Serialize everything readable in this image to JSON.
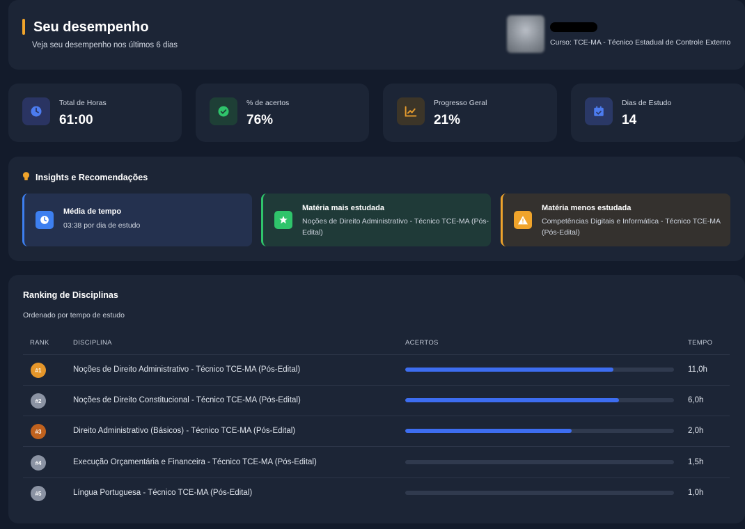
{
  "header": {
    "title": "Seu desempenho",
    "subtitle": "Veja seu desempenho nos últimos 6 dias",
    "course": "Curso: TCE-MA - Técnico Estadual de Controle Externo"
  },
  "stats": [
    {
      "label": "Total de Horas",
      "value": "61:00",
      "icon": "clock-icon",
      "color": "#4c7cf0",
      "bg": "#2a3462"
    },
    {
      "label": "% de acertos",
      "value": "76%",
      "icon": "check-circle-icon",
      "color": "#2fc46b",
      "bg": "#1e3f36"
    },
    {
      "label": "Progresso Geral",
      "value": "21%",
      "icon": "trend-chart-icon",
      "color": "#e59b2e",
      "bg": "#3c3528"
    },
    {
      "label": "Dias de Estudo",
      "value": "14",
      "icon": "calendar-check-icon",
      "color": "#4c7cf0",
      "bg": "#2a3866"
    }
  ],
  "insights": {
    "title": "Insights e Recomendações",
    "items": [
      {
        "title": "Média de tempo",
        "text": "03:38 por dia de estudo",
        "icon": "clock-icon",
        "accent": "#3d7ff0",
        "bg": "#24314f"
      },
      {
        "title": "Matéria mais estudada",
        "text": "Noções de Direito Administrativo - Técnico TCE-MA (Pós-Edital)",
        "icon": "star-icon",
        "accent": "#2fc46b",
        "bg": "#1f3a38"
      },
      {
        "title": "Matéria menos estudada",
        "text": "Competências Digitais e Informática - Técnico TCE-MA (Pós-Edital)",
        "icon": "warning-icon",
        "accent": "#f0a42b",
        "bg": "#34312e"
      }
    ]
  },
  "ranking": {
    "title": "Ranking de Disciplinas",
    "subtitle": "Ordenado por tempo de estudo",
    "headers": {
      "rank": "RANK",
      "discipline": "DISCIPLINA",
      "accuracy": "ACERTOS",
      "time": "TEMPO"
    },
    "rows": [
      {
        "rank": "#1",
        "badge_color": "#e5962a",
        "discipline": "Noções de Direito Administrativo - Técnico TCE-MA (Pós-Edital)",
        "accuracy_fraction": 0.775,
        "time": "11,0h"
      },
      {
        "rank": "#2",
        "badge_color": "#8b93a3",
        "discipline": "Noções de Direito Constitucional - Técnico TCE-MA (Pós-Edital)",
        "accuracy_fraction": 0.795,
        "time": "6,0h"
      },
      {
        "rank": "#3",
        "badge_color": "#c0621e",
        "discipline": "Direito Administrativo (Básicos) - Técnico TCE-MA (Pós-Edital)",
        "accuracy_fraction": 0.62,
        "time": "2,0h"
      },
      {
        "rank": "#4",
        "badge_color": "#8b93a3",
        "discipline": "Execução Orçamentária e Financeira - Técnico TCE-MA (Pós-Edital)",
        "accuracy_fraction": 0,
        "time": "1,5h"
      },
      {
        "rank": "#5",
        "badge_color": "#8b93a3",
        "discipline": "Língua Portuguesa - Técnico TCE-MA (Pós-Edital)",
        "accuracy_fraction": 0,
        "time": "1,0h"
      }
    ]
  }
}
